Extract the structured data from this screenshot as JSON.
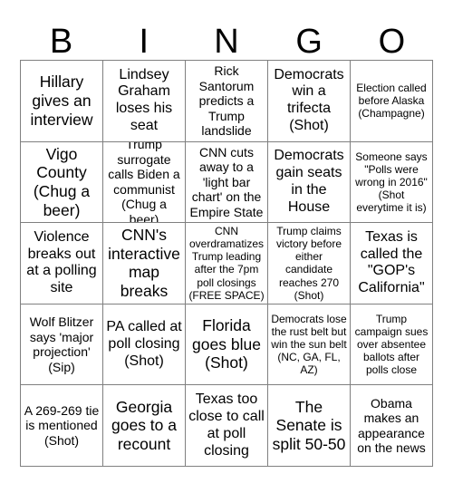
{
  "card": {
    "header_letters": [
      "B",
      "I",
      "N",
      "G",
      "O"
    ],
    "columns": 5,
    "rows": 5,
    "border_color": "#808080",
    "text_color": "#000000",
    "background_color": "#ffffff",
    "free_space_index": 12,
    "cells": [
      {
        "text": "Hillary gives an interview",
        "size": "fs-xl"
      },
      {
        "text": "Lindsey Graham loses his seat",
        "size": "fs-lg"
      },
      {
        "text": "Rick Santorum predicts a Trump landslide",
        "size": "fs-md"
      },
      {
        "text": "Democrats win a trifecta (Shot)",
        "size": "fs-lg"
      },
      {
        "text": "Election called before Alaska (Champagne)",
        "size": "fs-sm"
      },
      {
        "text": "Vigo County (Chug a beer)",
        "size": "fs-xl"
      },
      {
        "text": "Trump surrogate calls Biden a communist (Chug a beer)",
        "size": "fs-md"
      },
      {
        "text": "CNN cuts away to a 'light bar chart' on the Empire State",
        "size": "fs-md"
      },
      {
        "text": "Democrats gain seats in the House",
        "size": "fs-lg"
      },
      {
        "text": "Someone says \"Polls were wrong in 2016\" (Shot everytime it is)",
        "size": "fs-sm"
      },
      {
        "text": "Violence breaks out at a polling site",
        "size": "fs-lg"
      },
      {
        "text": "CNN's interactive map breaks",
        "size": "fs-xl"
      },
      {
        "text": "CNN overdramatizes Trump leading after the 7pm poll closings (FREE SPACE)",
        "size": "fs-sm"
      },
      {
        "text": "Trump claims victory before either candidate reaches 270 (Shot)",
        "size": "fs-sm"
      },
      {
        "text": "Texas is called the \"GOP's California\"",
        "size": "fs-lg"
      },
      {
        "text": "Wolf Blitzer says 'major projection' (Sip)",
        "size": "fs-md"
      },
      {
        "text": "PA called at poll closing (Shot)",
        "size": "fs-lg"
      },
      {
        "text": "Florida goes blue (Shot)",
        "size": "fs-xl"
      },
      {
        "text": "Democrats lose the rust belt but win the sun belt (NC, GA, FL, AZ)",
        "size": "fs-sm"
      },
      {
        "text": "Trump campaign sues over absentee ballots after polls close",
        "size": "fs-sm"
      },
      {
        "text": "A 269-269 tie is mentioned (Shot)",
        "size": "fs-md"
      },
      {
        "text": "Georgia goes to a recount",
        "size": "fs-xl"
      },
      {
        "text": "Texas too close to call at poll closing",
        "size": "fs-lg"
      },
      {
        "text": "The Senate is split 50-50",
        "size": "fs-xl"
      },
      {
        "text": "Obama makes an appearance on the news",
        "size": "fs-md"
      }
    ]
  }
}
